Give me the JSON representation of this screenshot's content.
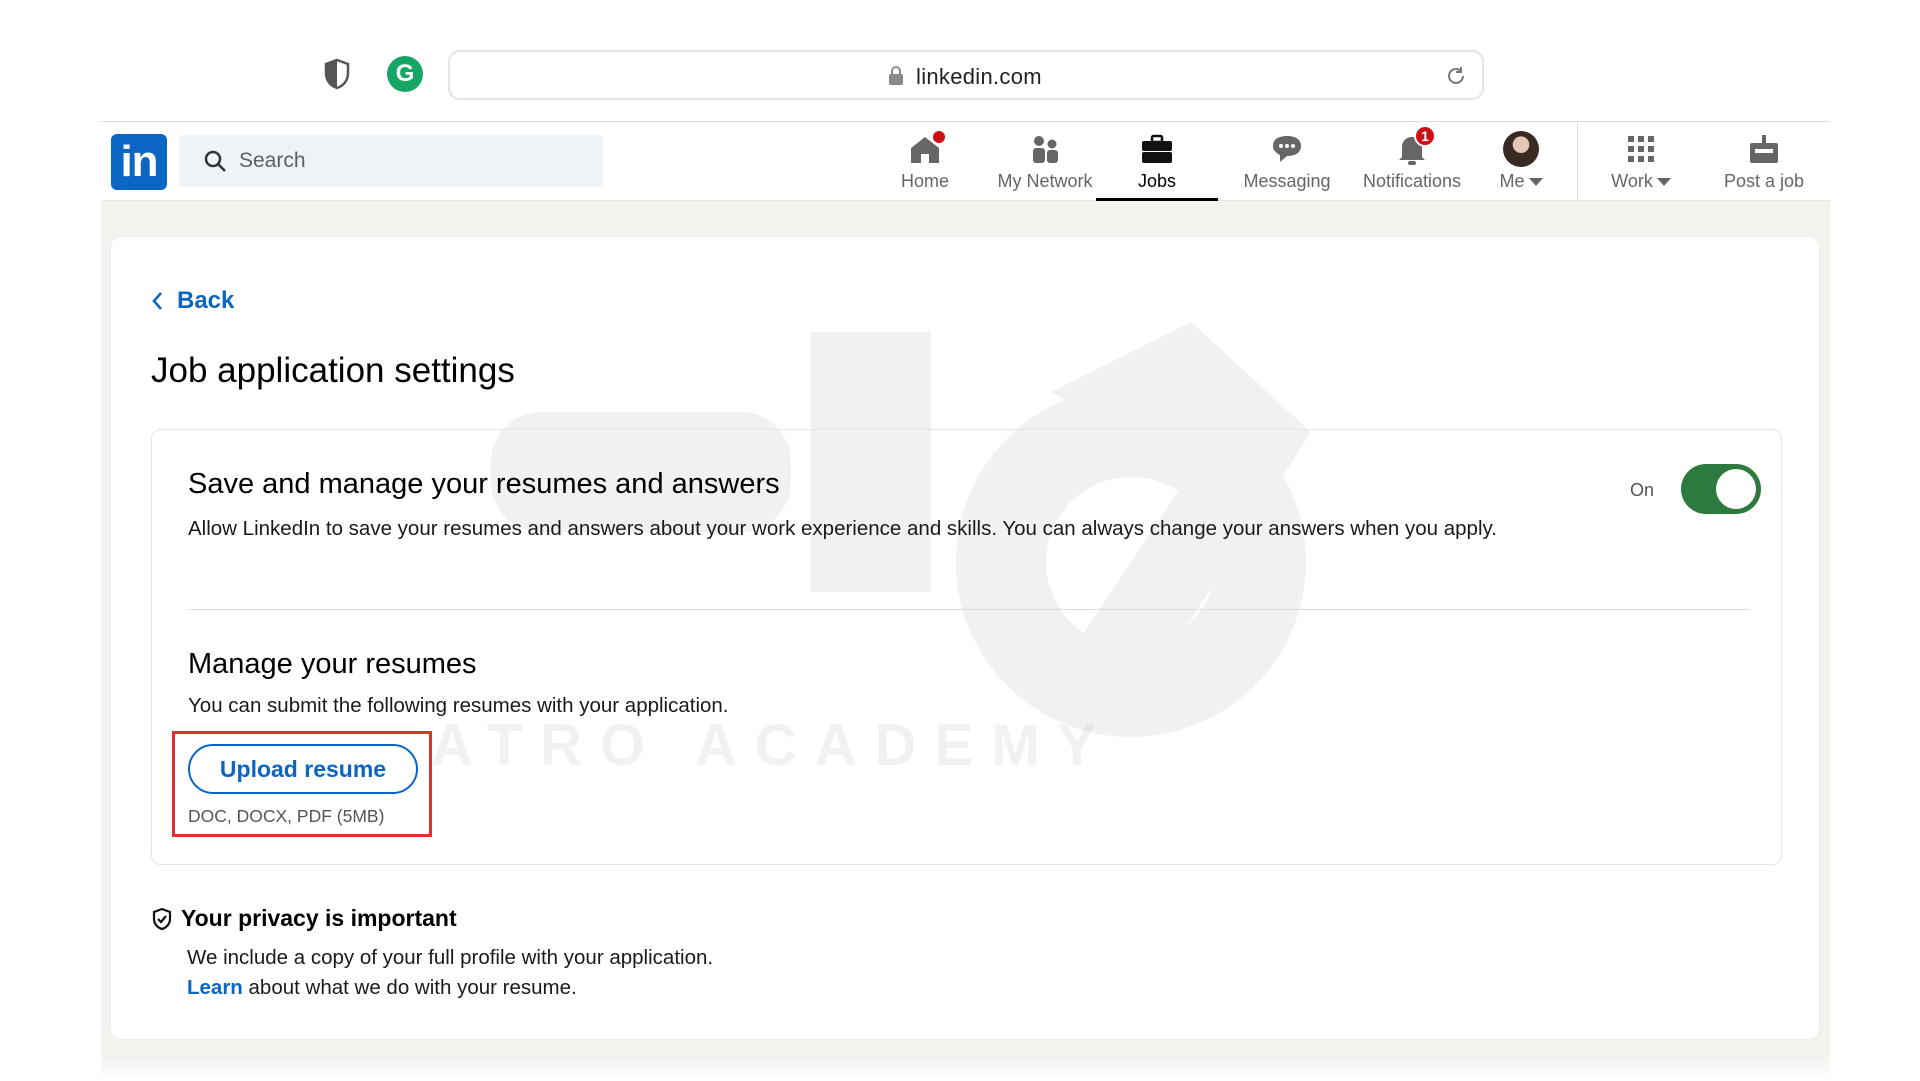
{
  "browser": {
    "url": "linkedin.com",
    "extension_icons": [
      "shield-icon",
      "grammarly-icon"
    ],
    "grammarly_letter": "G"
  },
  "nav": {
    "logo": "in",
    "search_placeholder": "Search",
    "items": [
      {
        "label": "Home",
        "icon": "home-icon",
        "dot": true
      },
      {
        "label": "My Network",
        "icon": "network-icon"
      },
      {
        "label": "Jobs",
        "icon": "briefcase-icon",
        "active": true
      },
      {
        "label": "Messaging",
        "icon": "messaging-icon"
      },
      {
        "label": "Notifications",
        "icon": "bell-icon",
        "badge": "1"
      },
      {
        "label": "Me",
        "icon": "avatar",
        "caret": true
      },
      {
        "label": "Work",
        "icon": "grid-icon",
        "caret": true
      },
      {
        "label": "Post a job",
        "icon": "post-job-icon"
      }
    ]
  },
  "page": {
    "back_label": "Back",
    "title": "Job application settings",
    "watermark": "ATRO ACADEMY"
  },
  "save_section": {
    "heading": "Save and manage your resumes and answers",
    "description": "Allow LinkedIn to save your resumes and answers about your work experience and skills. You can always change your answers when you apply.",
    "toggle_label": "On",
    "toggle_on": true
  },
  "resumes_section": {
    "heading": "Manage your resumes",
    "description": "You can submit the following resumes with your application.",
    "upload_label": "Upload resume",
    "file_types": "DOC, DOCX, PDF (5MB)"
  },
  "privacy": {
    "heading": "Your privacy is important",
    "line1": "We include a copy of your full profile with your application.",
    "learn_link": "Learn",
    "line2_rest": " about what we do with your resume."
  },
  "colors": {
    "brand": "#0a66c2",
    "toggle_on": "#2d7a3e",
    "badge": "#cc1016",
    "highlight": "#e0312f"
  }
}
